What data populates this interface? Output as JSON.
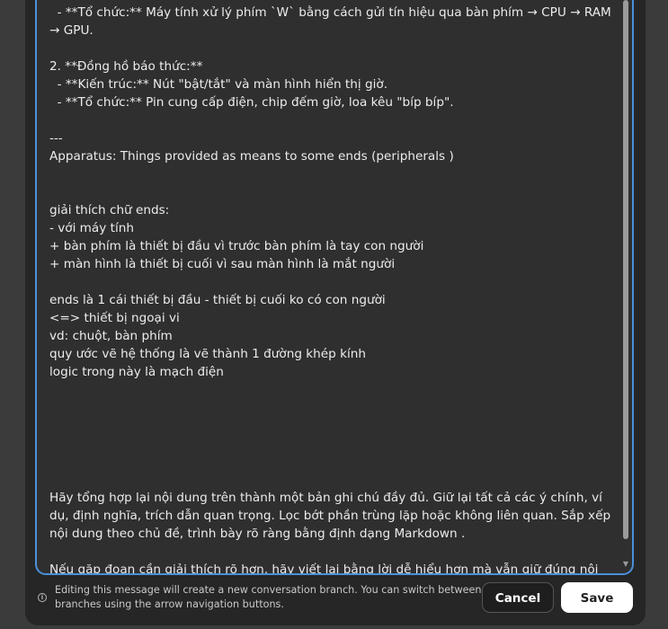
{
  "editor": {
    "content": "  - **Tổ chức:** Máy tính xử lý phím `W` bằng cách gửi tín hiệu qua bàn phím → CPU → RAM → GPU.\n\n2. **Đồng hồ báo thức:**\n  - **Kiến trúc:** Nút \"bật/tắt\" và màn hình hiển thị giờ.\n  - **Tổ chức:** Pin cung cấp điện, chip đếm giờ, loa kêu \"bíp bíp\".\n\n---\nApparatus: Things provided as means to some ends (peripherals )\n\n\ngiải thích chữ ends:\n- với máy tính\n+ bàn phím là thiết bị đầu vì trước bàn phím là tay con người\n+ màn hình là thiết bị cuối vì sau màn hình là mắt người\n\nends là 1 cái thiết bị đầu - thiết bị cuối ko có con người\n<=> thiết bị ngoại vi\nvd: chuột, bàn phím\nquy ước vẽ hệ thống là vẽ thành 1 đường khép kính\nlogic trong này là mạch điện\n\n\n\n\n\n\nHãy tổng hợp lại nội dung trên thành một bản ghi chú đầy đủ. Giữ lại tất cả các ý chính, ví dụ, định nghĩa, trích dẫn quan trọng. Lọc bớt phần trùng lặp hoặc không liên quan. Sắp xếp nội dung theo chủ đề, trình bày rõ ràng bằng định dạng Markdown .\n\nNếu gặp đoạn cần giải thích rõ hơn, hãy viết lại bằng lời dễ hiểu hơn mà vẫn giữ đúng nội dung"
  },
  "footer": {
    "notice": "Editing this message will create a new conversation branch. You can switch between branches using the arrow navigation buttons.",
    "cancel_label": "Cancel",
    "save_label": "Save",
    "info_icon": "info-icon"
  },
  "colors": {
    "focus_border": "#4a90d9",
    "editor_bg": "#2f2f2f",
    "panel_bg": "#262626",
    "save_bg": "#ffffff",
    "cancel_bg": "#1e1e1e"
  }
}
